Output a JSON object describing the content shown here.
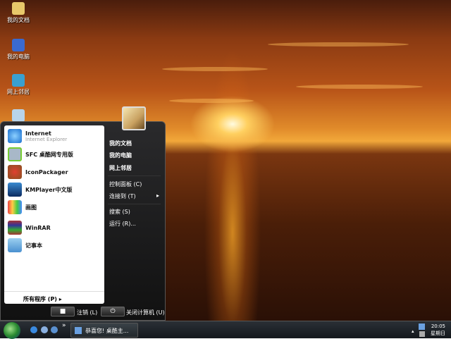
{
  "desktop": {
    "icons": [
      {
        "label": "我的文档"
      },
      {
        "label": "我的电脑"
      },
      {
        "label": "网上邻居"
      },
      {
        "label": ""
      }
    ]
  },
  "start_menu": {
    "pinned": [
      {
        "label": "Internet",
        "sub": "Internet Explorer"
      },
      {
        "label": "SFC 桌酷网专用版"
      },
      {
        "label": "IconPackager"
      },
      {
        "label": "KMPlayer中文版"
      },
      {
        "label": "画图"
      },
      {
        "label": "WinRAR"
      },
      {
        "label": "记事本"
      }
    ],
    "all_programs": "所有程序 (P)",
    "right": [
      "我的文档",
      "我的电脑",
      "网上邻居",
      "控制面板 (C)",
      "连接到 (T)",
      "搜索 (S)",
      "运行 (R)..."
    ],
    "logoff": "注销 (L)",
    "shutdown": "关闭计算机 (U)"
  },
  "taskbar": {
    "task": "恭喜您! 桌酷主...",
    "chevron": "»",
    "time": "20:05",
    "day": "星期日"
  }
}
